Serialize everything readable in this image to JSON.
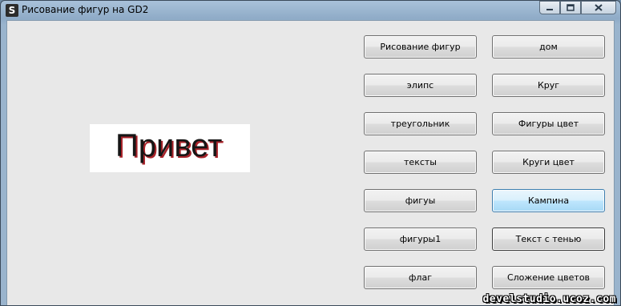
{
  "window": {
    "title": "Рисование фигур на GD2",
    "icon_letter": "S"
  },
  "greeting": "Привет",
  "buttons_left": [
    "Рисование фигур",
    "элипс",
    "треугольник",
    "тексты",
    "фигуы",
    "фигуры1",
    "флаг"
  ],
  "buttons_right": [
    "дом",
    "Круг",
    "Фигуры цвет",
    "Круги цвет",
    "Кампина",
    "Текст с тенью",
    "Сложение цветов"
  ],
  "watermark": "develstudio.ucoz.com"
}
